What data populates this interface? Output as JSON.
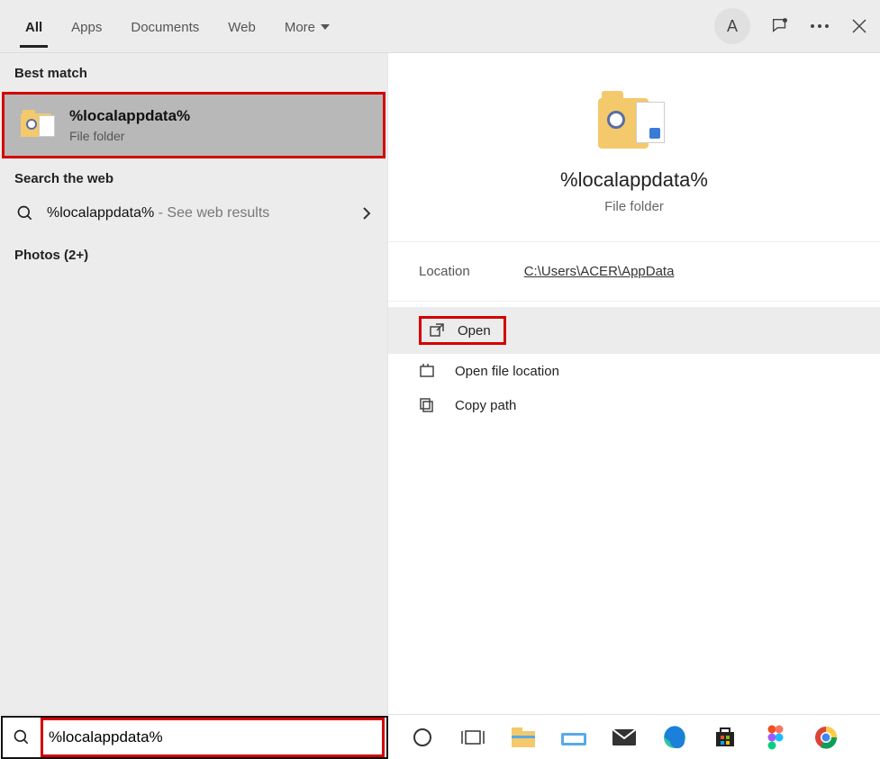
{
  "header": {
    "tabs": [
      "All",
      "Apps",
      "Documents",
      "Web",
      "More"
    ],
    "active_tab_index": 0,
    "avatar_initial": "A"
  },
  "left": {
    "best_match_label": "Best match",
    "best_match": {
      "title": "%localappdata%",
      "subtitle": "File folder"
    },
    "search_web_label": "Search the web",
    "web_result": {
      "query": "%localappdata%",
      "suffix": " - See web results"
    },
    "photos_label": "Photos (2+)"
  },
  "right": {
    "title": "%localappdata%",
    "subtitle": "File folder",
    "location_label": "Location",
    "location_value": "C:\\Users\\ACER\\AppData",
    "actions": {
      "open": "Open",
      "open_location": "Open file location",
      "copy_path": "Copy path"
    }
  },
  "search": {
    "value": "%localappdata%"
  }
}
